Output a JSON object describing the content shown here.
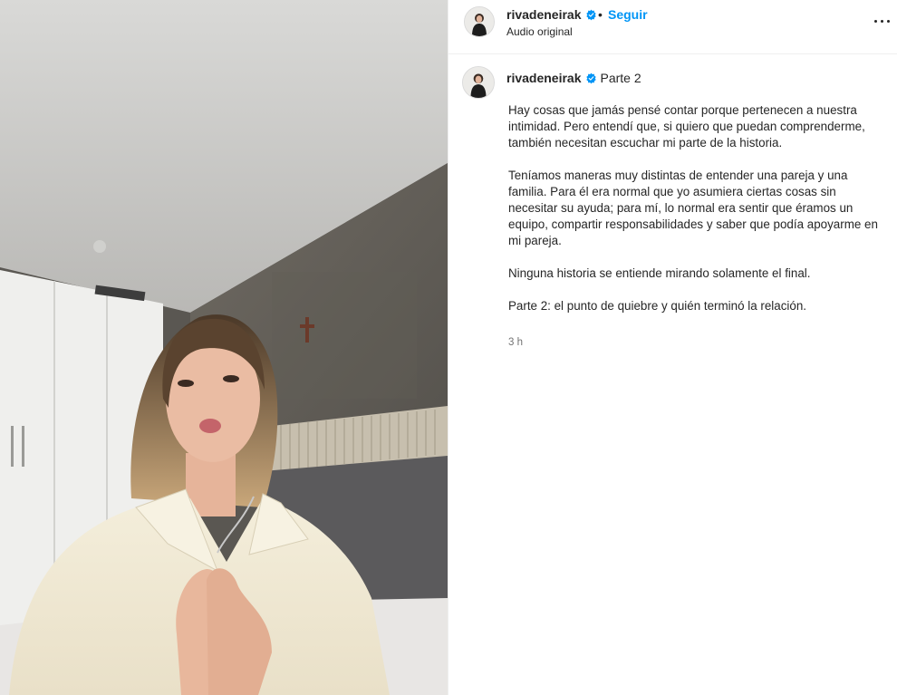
{
  "header": {
    "username": "rivadeneirak",
    "separator": "•",
    "follow_label": "Seguir",
    "audio_label": "Audio original",
    "more_icon": "more-options-icon"
  },
  "caption": {
    "username": "rivadeneirak",
    "title": "Parte 2",
    "paragraphs": [
      "Hay cosas que jamás pensé contar porque pertenecen a nuestra intimidad. Pero entendí que, si quiero que puedan comprenderme, también necesitan escuchar mi parte de la historia.",
      "Teníamos maneras muy distintas de entender una pareja y una familia. Para él era normal que yo asumiera ciertas cosas sin necesitar su ayuda; para mí, lo normal era sentir que éramos un equipo, compartir responsabilidades y saber que podía apoyarme en mi pareja.",
      "Ninguna historia se entiende mirando solamente el final.",
      "Parte 2: el punto de quiebre y quién terminó la relación."
    ],
    "timestamp": "3 h"
  },
  "colors": {
    "link_blue": "#0095f6",
    "verified_blue": "#0095f6",
    "text": "#262626",
    "muted": "#737373"
  }
}
